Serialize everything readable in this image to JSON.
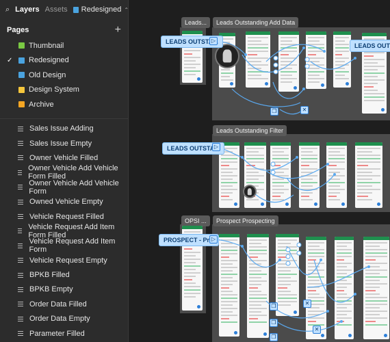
{
  "topbar": {
    "tabs": [
      "Layers",
      "Assets"
    ],
    "file_name": "Redesigned"
  },
  "pages": {
    "title": "Pages",
    "items": [
      {
        "label": "Thumbnail",
        "color": "#7ac943",
        "selected": false
      },
      {
        "label": "Redesigned",
        "color": "#4aa3df",
        "selected": true
      },
      {
        "label": "Old Design",
        "color": "#4aa3df",
        "selected": false
      },
      {
        "label": "Design System",
        "color": "#f5c63c",
        "selected": false
      },
      {
        "label": "Archive",
        "color": "#f5a623",
        "selected": false
      }
    ]
  },
  "layers": [
    "Sales Issue Adding",
    "Sales Issue Empty",
    "Owner Vehicle Filled",
    "Owner Vehicle Add Vehicle Form Filled",
    "Owner Vehicle Add Vehicle Form",
    "Owned Vehicle Empty",
    "Vehicle Request Filled",
    "Vehicle Request Add Item Form Filled",
    "Vehicle Request Add Item Form",
    "Vehicle Request Empty",
    "BPKB Filled",
    "BPKB Empty",
    "Order Data Filled",
    "Order Data Empty",
    "Parameter Filled"
  ],
  "canvas": {
    "section_labels": {
      "leads_short": "Leads...",
      "leads_add": "Leads Outstanding Add Data",
      "leads_filter": "Leads Outstanding Filter",
      "opsi": "OPSI ...",
      "prospect": "Prospect Prospecting"
    },
    "flow_labels": {
      "leads1": "LEADS OUTSTA...",
      "leads_right": "LEADS OUTSTA",
      "leads2": "LEADS OUTSTA...",
      "prospect": "PROSPECT - Pr..."
    }
  }
}
